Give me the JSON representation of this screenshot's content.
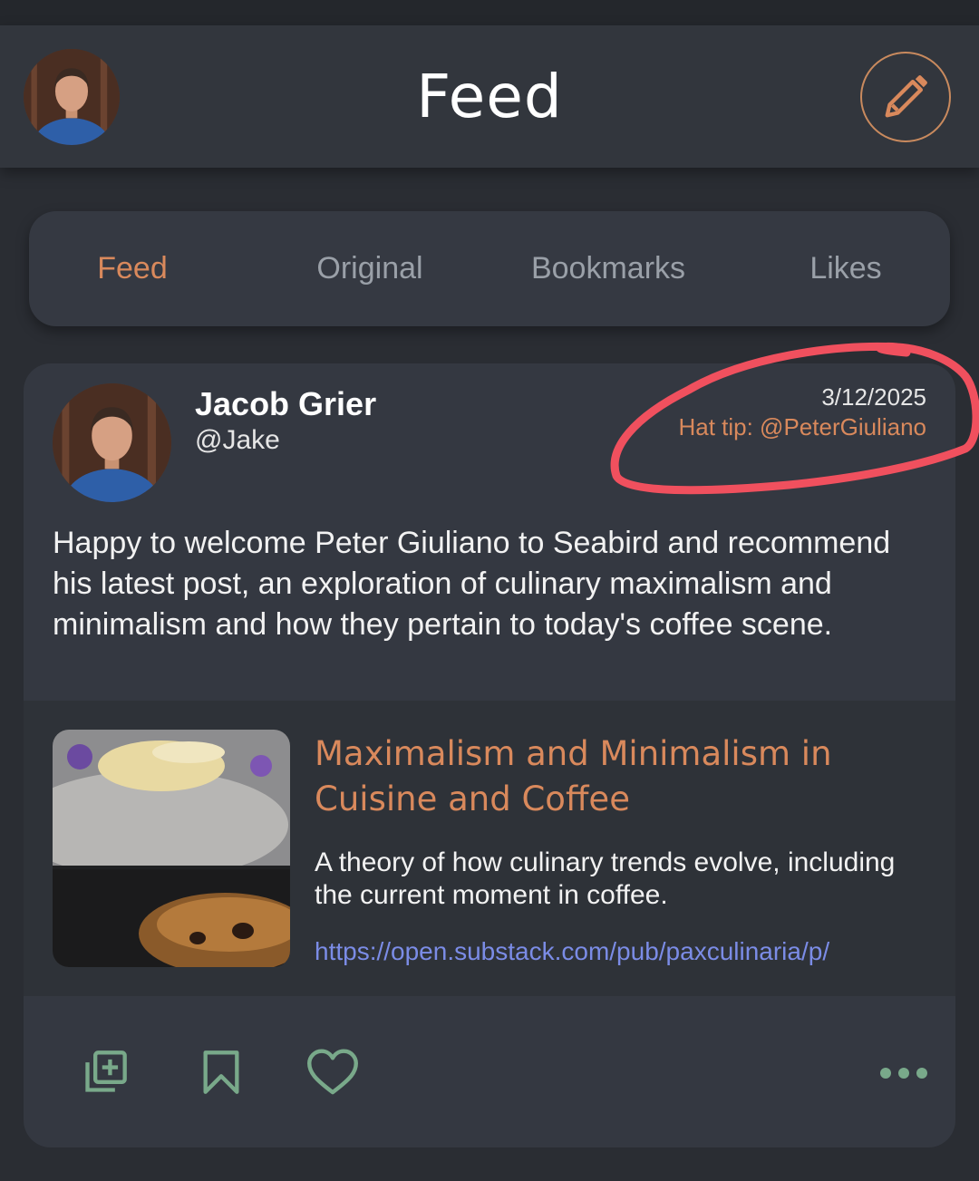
{
  "header": {
    "title": "Feed",
    "avatar_icon": "user-avatar",
    "compose_icon": "pencil-icon"
  },
  "tabs": [
    {
      "label": "Feed",
      "active": true
    },
    {
      "label": "Original",
      "active": false
    },
    {
      "label": "Bookmarks",
      "active": false
    },
    {
      "label": "Likes",
      "active": false
    }
  ],
  "post": {
    "author_name": "Jacob Grier",
    "author_handle": "@Jake",
    "date": "3/12/2025",
    "hat_tip": "Hat tip: @PeterGiuliano",
    "text": "Happy to welcome Peter Giuliano to Seabird and recommend his latest post, an exploration of culinary maximalism and minimalism and how they pertain to today's coffee scene.",
    "link_preview": {
      "title": "Maximalism and Minimalism in Cuisine and Coffee",
      "description": "A theory of how culinary trends evolve, including the current moment in coffee.",
      "url": "https://open.substack.com/pub/paxculinaria/p/"
    },
    "actions": [
      "add-to-list-icon",
      "bookmark-icon",
      "heart-icon",
      "more-icon"
    ]
  },
  "colors": {
    "accent": "#d9895c",
    "action_icons": "#79a98a",
    "link": "#7b8ce6",
    "annotation": "#f0505e",
    "background": "#2a2d33",
    "card": "#343841"
  }
}
